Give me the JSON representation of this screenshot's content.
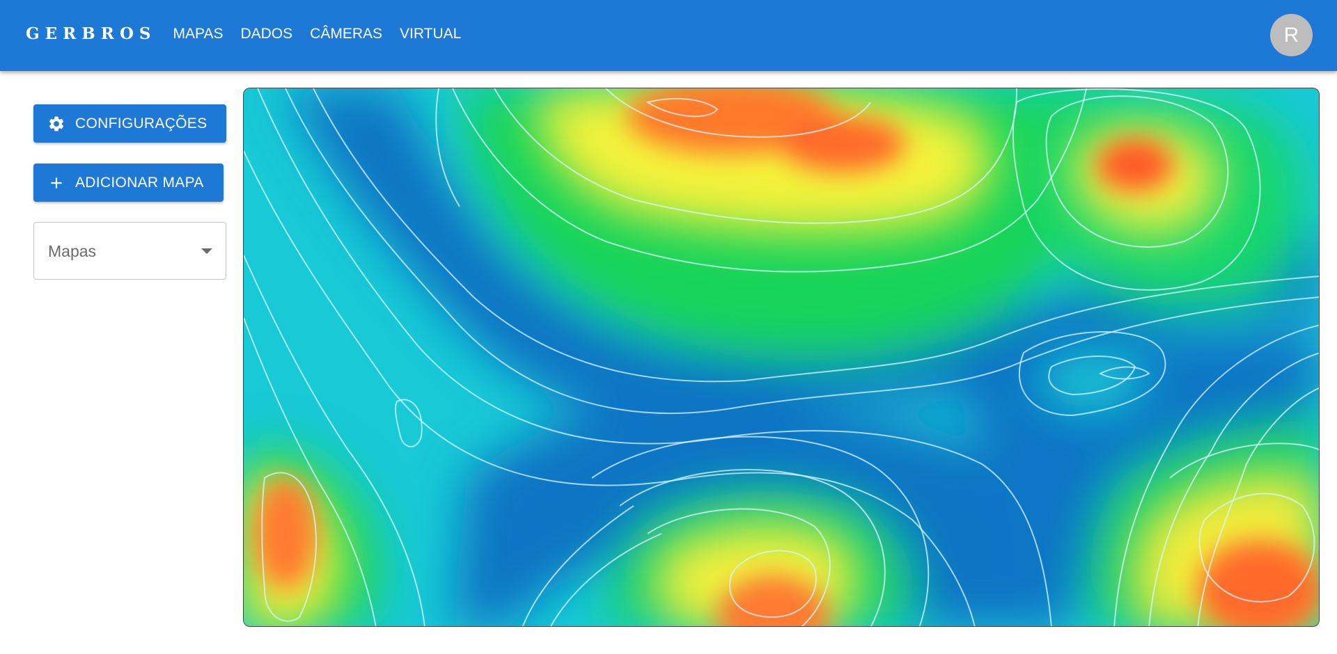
{
  "header": {
    "brand": "GERBROS",
    "nav": [
      "MAPAS",
      "DADOS",
      "CÂMERAS",
      "VIRTUAL"
    ],
    "avatar_letter": "R"
  },
  "sidebar": {
    "config_button": {
      "label": "CONFIGURAÇÕES",
      "icon": "gear-icon"
    },
    "add_map_button": {
      "label": "ADICIONAR MAPA",
      "icon": "plus-icon"
    },
    "maps_select": {
      "value": "Mapas"
    }
  },
  "colors": {
    "appbar": "#1e78d6",
    "button": "#1e78d6",
    "avatar": "#bdbdbd"
  }
}
